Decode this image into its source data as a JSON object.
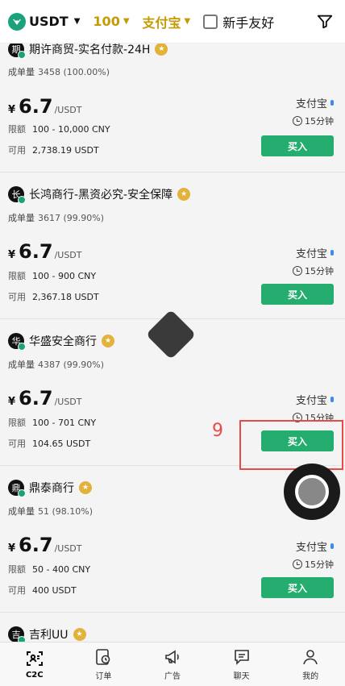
{
  "topbar": {
    "coin": "USDT",
    "amount": "100",
    "payment": "支付宝",
    "newbie_label": "新手友好"
  },
  "labels": {
    "deals_key": "成单量",
    "unit": "/USDT",
    "currency": "¥",
    "limit_key": "限额",
    "avail_key": "可用",
    "buy": "买入"
  },
  "offers": [
    {
      "merchant": "期许商贸-实名付款-24H",
      "avatar": "期",
      "deals": "3458 (100.00%)",
      "price": "6.7",
      "limit": "100 - 10,000 CNY",
      "available": "2,738.19 USDT",
      "payment": "支付宝",
      "time": "15分钟"
    },
    {
      "merchant": "长鸿商行-黑资必究-安全保障",
      "avatar": "长",
      "deals": "3617 (99.90%)",
      "price": "6.7",
      "limit": "100 - 900 CNY",
      "available": "2,367.18 USDT",
      "payment": "支付宝",
      "time": "15分钟"
    },
    {
      "merchant": "华盛安全商行",
      "avatar": "华",
      "deals": "4387 (99.90%)",
      "price": "6.7",
      "limit": "100 - 701 CNY",
      "available": "104.65 USDT",
      "payment": "支付宝",
      "time": "15分钟"
    },
    {
      "merchant": "鼎泰商行",
      "avatar": "鼎",
      "deals": "51 (98.10%)",
      "price": "6.7",
      "limit": "50 - 400 CNY",
      "available": "400 USDT",
      "payment": "支付宝",
      "time": "15分钟"
    },
    {
      "merchant": "吉利UU",
      "avatar": "吉"
    }
  ],
  "annotation": {
    "step": "9"
  },
  "tabs": [
    {
      "label": "C2C",
      "icon": "c2c-icon"
    },
    {
      "label": "订单",
      "icon": "orders-icon"
    },
    {
      "label": "广告",
      "icon": "megaphone-icon"
    },
    {
      "label": "聊天",
      "icon": "chat-icon"
    },
    {
      "label": "我的",
      "icon": "profile-icon"
    }
  ],
  "colors": {
    "accent_gold": "#c49a05",
    "buy_green": "#24ad6f",
    "annotation_red": "#e84a4a"
  }
}
